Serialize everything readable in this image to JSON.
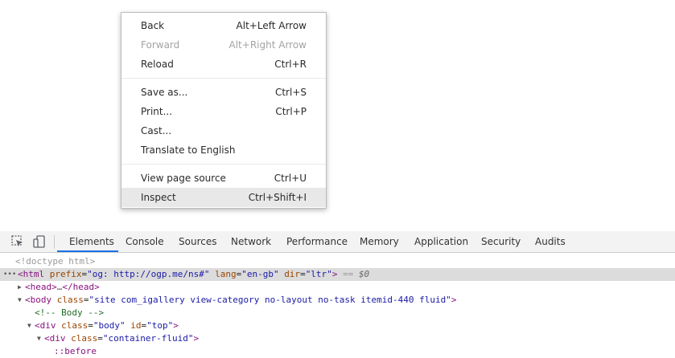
{
  "context_menu": {
    "items": [
      {
        "label": "Back",
        "shortcut": "Alt+Left Arrow",
        "disabled": false
      },
      {
        "label": "Forward",
        "shortcut": "Alt+Right Arrow",
        "disabled": true
      },
      {
        "label": "Reload",
        "shortcut": "Ctrl+R",
        "disabled": false
      },
      {
        "label": "Save as...",
        "shortcut": "Ctrl+S",
        "disabled": false
      },
      {
        "label": "Print...",
        "shortcut": "Ctrl+P",
        "disabled": false
      },
      {
        "label": "Cast...",
        "shortcut": "",
        "disabled": false
      },
      {
        "label": "Translate to English",
        "shortcut": "",
        "disabled": false
      },
      {
        "label": "View page source",
        "shortcut": "Ctrl+U",
        "disabled": false
      },
      {
        "label": "Inspect",
        "shortcut": "Ctrl+Shift+I",
        "disabled": false,
        "highlighted": true
      }
    ]
  },
  "devtools": {
    "icons": [
      "inspect-element-icon",
      "device-toolbar-icon"
    ],
    "tabs": [
      "Elements",
      "Console",
      "Sources",
      "Network",
      "Performance",
      "Memory",
      "Application",
      "Security",
      "Audits"
    ],
    "active_tab": "Elements",
    "accent_color": "#1a73e8",
    "tree": {
      "doctype": "<!doctype html>",
      "html_open": "<html",
      "html_prefix_attr": "prefix",
      "html_prefix_val": "\"og: http://ogp.me/ns#\"",
      "html_lang_attr": "lang",
      "html_lang_val": "\"en-gb\"",
      "html_dir_attr": "dir",
      "html_dir_val": "\"ltr\"",
      "html_close": ">",
      "html_eq": "==",
      "html_dollar": "$0",
      "head_open": "<head>",
      "head_ellipsis": "…",
      "head_close": "</head>",
      "body_open": "<body",
      "body_class_attr": "class",
      "body_class_val": "\"site com_igallery view-category no-layout no-task itemid-440 fluid\"",
      "body_close": ">",
      "comment": "<!-- Body -->",
      "div1_open": "<div",
      "div1_class_attr": "class",
      "div1_class_val": "\"body\"",
      "div1_id_attr": "id",
      "div1_id_val": "\"top\"",
      "div1_close": ">",
      "div2_open": "<div",
      "div2_class_attr": "class",
      "div2_class_val": "\"container-fluid\"",
      "div2_close": ">",
      "pseudo": "::before"
    }
  }
}
